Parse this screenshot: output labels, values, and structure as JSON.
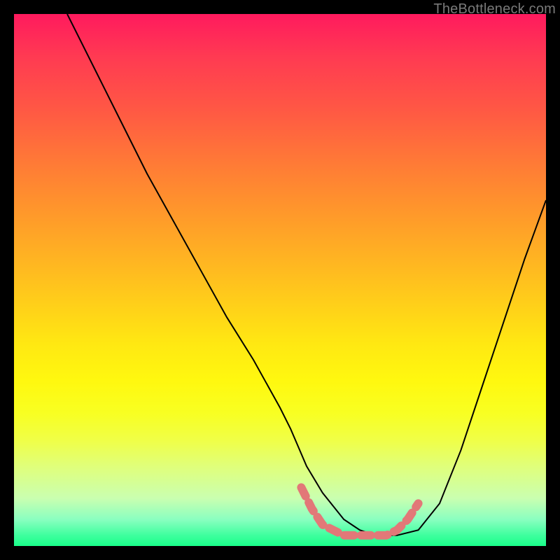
{
  "watermark": "TheBottleneck.com",
  "chart_data": {
    "type": "line",
    "title": "",
    "xlabel": "",
    "ylabel": "",
    "xlim": [
      0,
      100
    ],
    "ylim": [
      0,
      100
    ],
    "grid": false,
    "background": "rainbow-gradient (red top → green bottom)",
    "series": [
      {
        "name": "black-curve",
        "color": "#000000",
        "x": [
          10,
          15,
          20,
          25,
          30,
          35,
          40,
          45,
          50,
          52,
          55,
          58,
          62,
          65,
          68,
          72,
          76,
          80,
          84,
          88,
          92,
          96,
          100
        ],
        "y": [
          100,
          90,
          80,
          70,
          61,
          52,
          43,
          35,
          26,
          22,
          15,
          10,
          5,
          3,
          2,
          2,
          3,
          8,
          18,
          30,
          42,
          54,
          65
        ]
      },
      {
        "name": "pink-overlay-segment",
        "color": "#e27878",
        "x": [
          54,
          56,
          58,
          60,
          62,
          64,
          66,
          68,
          70,
          72,
          74,
          76
        ],
        "y": [
          11,
          7,
          4,
          3,
          2,
          2,
          2,
          2,
          2,
          3,
          5,
          8
        ]
      }
    ],
    "note": "x/y in percent of plot area; y=100 at top edge, y=0 at bottom edge."
  }
}
